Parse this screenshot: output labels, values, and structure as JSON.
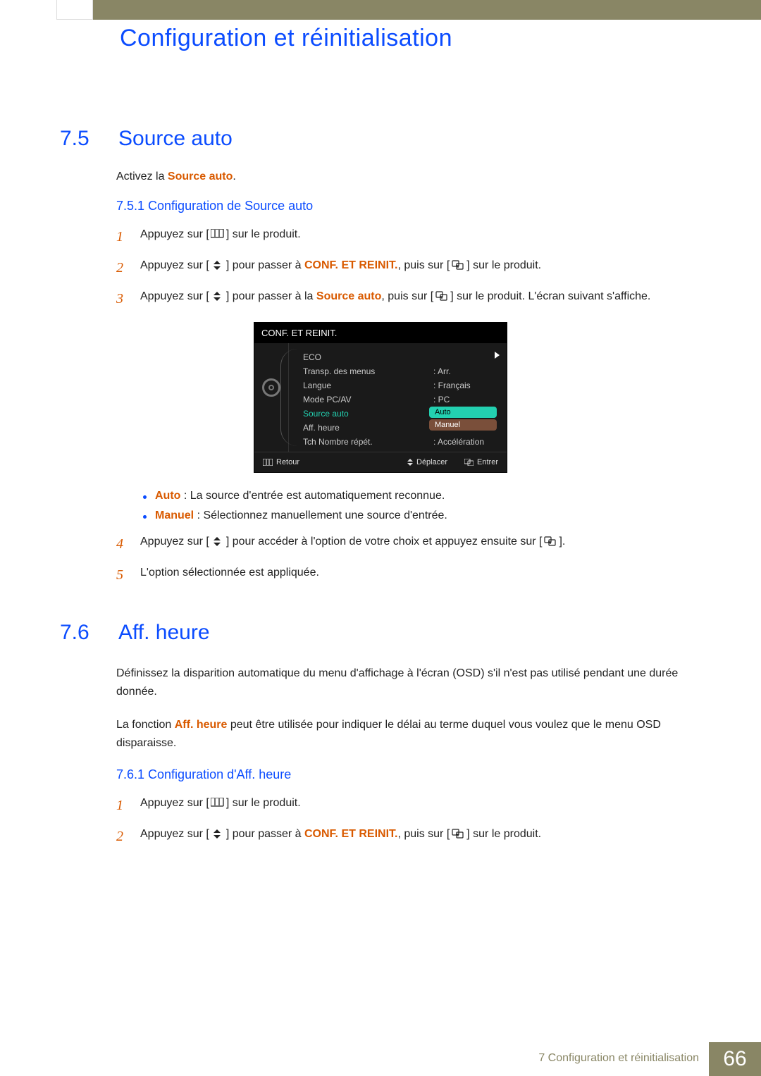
{
  "chapter_title": "Configuration et réinitialisation",
  "section_75": {
    "num": "7.5",
    "title": "Source auto",
    "intro_prefix": "Activez la ",
    "intro_highlight": "Source auto",
    "intro_suffix": ".",
    "sub_751": "7.5.1   Configuration de Source auto",
    "steps": {
      "s1": "Appuyez sur [",
      "s1b": "] sur le produit.",
      "s2a": "Appuyez sur [",
      "s2b": "] pour passer à ",
      "s2_hl": "CONF. ET REINIT.",
      "s2c": ", puis sur [",
      "s2d": "] sur le produit.",
      "s3a": "Appuyez sur [",
      "s3b": "] pour passer à la ",
      "s3_hl": "Source auto",
      "s3c": ", puis sur [",
      "s3d": "] sur le produit. L'écran suivant s'affiche.",
      "s4a": "Appuyez sur [",
      "s4b": "] pour accéder à l'option de votre choix et appuyez ensuite sur [",
      "s4c": "].",
      "s5": "L'option sélectionnée est appliquée."
    },
    "bullets": {
      "auto_label": "Auto",
      "auto_text": " : La source d'entrée est automatiquement reconnue.",
      "manuel_label": "Manuel",
      "manuel_text": " : Sélectionnez manuellement une source d'entrée."
    }
  },
  "osd": {
    "title": "CONF. ET REINIT.",
    "rows": {
      "eco": "ECO",
      "transp": "Transp. des menus",
      "transp_val": ": Arr.",
      "langue": "Langue",
      "langue_val": ": Français",
      "pcav": "Mode PC/AV",
      "pcav_val": ": PC",
      "source": "Source auto",
      "source_colon": ":",
      "aff": "Aff. heure",
      "aff_val": ":",
      "tch": "Tch Nombre répét.",
      "tch_val": ": Accélération"
    },
    "popup": {
      "auto": "Auto",
      "manuel": "Manuel"
    },
    "footer": {
      "retour": "Retour",
      "deplacer": "Déplacer",
      "entrer": "Entrer"
    }
  },
  "section_76": {
    "num": "7.6",
    "title": "Aff. heure",
    "para1": "Définissez la disparition automatique du menu d'affichage à l'écran (OSD) s'il n'est pas utilisé pendant une durée donnée.",
    "para2a": "La fonction ",
    "para2_hl": "Aff. heure",
    "para2b": " peut être utilisée pour indiquer le délai au terme duquel vous voulez que le menu OSD disparaisse.",
    "sub_761": "7.6.1   Configuration d'Aff. heure",
    "steps": {
      "s1": "Appuyez sur [",
      "s1b": "] sur le produit.",
      "s2a": "Appuyez sur [",
      "s2b": "] pour passer à ",
      "s2_hl": "CONF. ET REINIT.",
      "s2c": ", puis sur [",
      "s2d": "] sur le produit."
    }
  },
  "footer": {
    "label": "7 Configuration et réinitialisation",
    "page": "66"
  },
  "step_numbers": {
    "n1": "1",
    "n2": "2",
    "n3": "3",
    "n4": "4",
    "n5": "5"
  }
}
